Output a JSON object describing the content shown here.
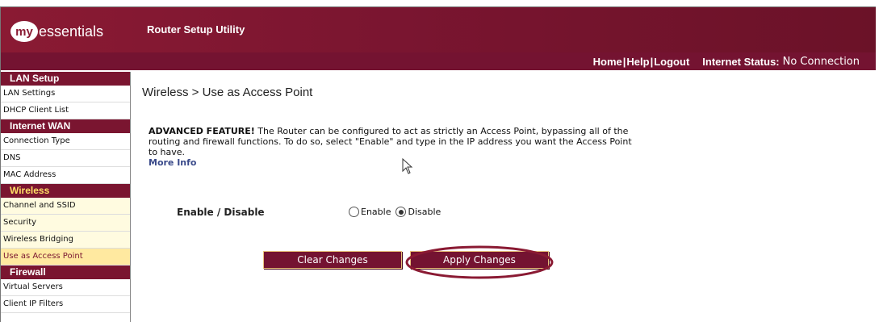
{
  "header": {
    "logo_my": "my",
    "logo_rest": "essentials",
    "app_title": "Router Setup Utility",
    "links": [
      "Home",
      "Help",
      "Logout"
    ],
    "status_label": "Internet Status:",
    "status_value": "No Connection"
  },
  "sidebar": {
    "sections": [
      {
        "title": "LAN Setup",
        "items": [
          "LAN Settings",
          "DHCP Client List"
        ]
      },
      {
        "title": "Internet WAN",
        "items": [
          "Connection Type",
          "DNS",
          "MAC Address"
        ]
      },
      {
        "title": "Wireless",
        "items": [
          "Channel and SSID",
          "Security",
          "Wireless Bridging",
          "Use as Access Point"
        ]
      },
      {
        "title": "Firewall",
        "items": [
          "Virtual Servers",
          "Client IP Filters"
        ]
      }
    ]
  },
  "main": {
    "page_title": "Wireless > Use as Access Point",
    "advanced_label": "ADVANCED FEATURE!",
    "description": " The Router can be configured to act as strictly an Access Point, bypassing all of the routing and firewall functions. To do so, select \"Enable\" and type in the IP address you want the Access Point to have.",
    "more_info": "More Info",
    "enable_label": "Enable / Disable",
    "options": [
      "Enable",
      "Disable"
    ],
    "selected_option": "Disable",
    "clear_button": "Clear Changes",
    "apply_button": "Apply Changes"
  },
  "colors": {
    "brand": "#7a1530",
    "highlight": "#ffe066",
    "wireless_bg": "#fffbe0"
  }
}
